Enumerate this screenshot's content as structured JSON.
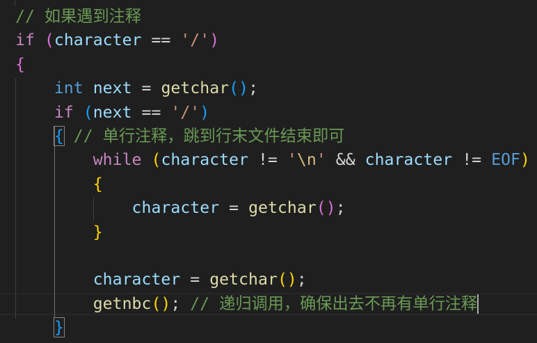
{
  "colors": {
    "comment": "#6a9955",
    "keyword": "#c586c0",
    "type": "#569cd6",
    "var": "#9cdcfe",
    "func": "#dcdcaa",
    "string": "#ce9178",
    "escape": "#d7ba7d",
    "op": "#d4d4d4",
    "gold": "#ffd700",
    "pink": "#da70d6",
    "blue": "#179fff",
    "macro": "#569cd6"
  },
  "cursor_line": 12,
  "lines": [
    [
      [
        "comment",
        "// 如果遇到注释"
      ]
    ],
    [
      [
        "keyword",
        "if"
      ],
      [
        "op",
        " "
      ],
      [
        "pink",
        "("
      ],
      [
        "var",
        "character"
      ],
      [
        "op",
        " == "
      ],
      [
        "string",
        "'/'"
      ],
      [
        "pink",
        ")"
      ]
    ],
    [
      [
        "pink",
        "{"
      ]
    ],
    [
      [
        "op",
        "    "
      ],
      [
        "type",
        "int"
      ],
      [
        "op",
        " "
      ],
      [
        "var",
        "next"
      ],
      [
        "op",
        " = "
      ],
      [
        "func",
        "getchar"
      ],
      [
        "blue",
        "()"
      ],
      [
        "op",
        ";"
      ]
    ],
    [
      [
        "op",
        "    "
      ],
      [
        "keyword",
        "if"
      ],
      [
        "op",
        " "
      ],
      [
        "blue",
        "("
      ],
      [
        "var",
        "next"
      ],
      [
        "op",
        " == "
      ],
      [
        "string",
        "'/'"
      ],
      [
        "blue",
        ")"
      ]
    ],
    [
      [
        "op",
        "    "
      ],
      [
        "blue",
        "{",
        "bm"
      ],
      [
        "op",
        " "
      ],
      [
        "comment",
        "// 单行注释，跳到行末文件结束即可"
      ]
    ],
    [
      [
        "op",
        "        "
      ],
      [
        "keyword",
        "while"
      ],
      [
        "op",
        " "
      ],
      [
        "gold",
        "("
      ],
      [
        "var",
        "character"
      ],
      [
        "op",
        " != "
      ],
      [
        "string",
        "'"
      ],
      [
        "escape",
        "\\n"
      ],
      [
        "string",
        "'"
      ],
      [
        "op",
        " && "
      ],
      [
        "var",
        "character"
      ],
      [
        "op",
        " != "
      ],
      [
        "macro",
        "EOF"
      ],
      [
        "gold",
        ")"
      ]
    ],
    [
      [
        "op",
        "        "
      ],
      [
        "gold",
        "{"
      ]
    ],
    [
      [
        "op",
        "            "
      ],
      [
        "var",
        "character"
      ],
      [
        "op",
        " = "
      ],
      [
        "func",
        "getchar"
      ],
      [
        "pink",
        "()"
      ],
      [
        "op",
        ";"
      ]
    ],
    [
      [
        "op",
        "        "
      ],
      [
        "gold",
        "}"
      ]
    ],
    [],
    [
      [
        "op",
        "        "
      ],
      [
        "var",
        "character"
      ],
      [
        "op",
        " = "
      ],
      [
        "func",
        "getchar"
      ],
      [
        "gold",
        "()"
      ],
      [
        "op",
        ";"
      ]
    ],
    [
      [
        "op",
        "        "
      ],
      [
        "func",
        "getnbc"
      ],
      [
        "gold",
        "()"
      ],
      [
        "op",
        "; "
      ],
      [
        "comment",
        "// 递归调用，确保出去不再有单行注释"
      ]
    ],
    [
      [
        "op",
        "    "
      ],
      [
        "blue",
        "}",
        "bm"
      ]
    ]
  ]
}
